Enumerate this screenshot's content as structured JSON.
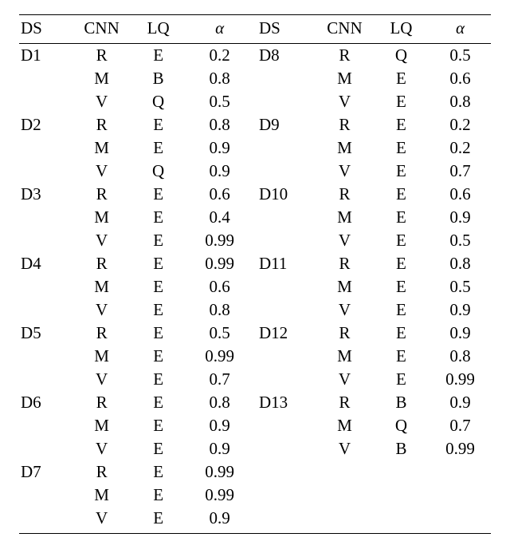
{
  "chart_data": {
    "type": "table",
    "title": "",
    "columns": [
      "DS",
      "CNN",
      "LQ",
      "alpha",
      "DS",
      "CNN",
      "LQ",
      "alpha"
    ],
    "rows": [
      [
        "D1",
        "R",
        "E",
        "0.2",
        "D8",
        "R",
        "Q",
        "0.5"
      ],
      [
        "",
        "M",
        "B",
        "0.8",
        "",
        "M",
        "E",
        "0.6"
      ],
      [
        "",
        "V",
        "Q",
        "0.5",
        "",
        "V",
        "E",
        "0.8"
      ],
      [
        "D2",
        "R",
        "E",
        "0.8",
        "D9",
        "R",
        "E",
        "0.2"
      ],
      [
        "",
        "M",
        "E",
        "0.9",
        "",
        "M",
        "E",
        "0.2"
      ],
      [
        "",
        "V",
        "Q",
        "0.9",
        "",
        "V",
        "E",
        "0.7"
      ],
      [
        "D3",
        "R",
        "E",
        "0.6",
        "D10",
        "R",
        "E",
        "0.6"
      ],
      [
        "",
        "M",
        "E",
        "0.4",
        "",
        "M",
        "E",
        "0.9"
      ],
      [
        "",
        "V",
        "E",
        "0.99",
        "",
        "V",
        "E",
        "0.5"
      ],
      [
        "D4",
        "R",
        "E",
        "0.99",
        "D11",
        "R",
        "E",
        "0.8"
      ],
      [
        "",
        "M",
        "E",
        "0.6",
        "",
        "M",
        "E",
        "0.5"
      ],
      [
        "",
        "V",
        "E",
        "0.8",
        "",
        "V",
        "E",
        "0.9"
      ],
      [
        "D5",
        "R",
        "E",
        "0.5",
        "D12",
        "R",
        "E",
        "0.9"
      ],
      [
        "",
        "M",
        "E",
        "0.99",
        "",
        "M",
        "E",
        "0.8"
      ],
      [
        "",
        "V",
        "E",
        "0.7",
        "",
        "V",
        "E",
        "0.99"
      ],
      [
        "D6",
        "R",
        "E",
        "0.8",
        "D13",
        "R",
        "B",
        "0.9"
      ],
      [
        "",
        "M",
        "E",
        "0.9",
        "",
        "M",
        "Q",
        "0.7"
      ],
      [
        "",
        "V",
        "E",
        "0.9",
        "",
        "V",
        "B",
        "0.99"
      ],
      [
        "D7",
        "R",
        "E",
        "0.99",
        "",
        "",
        "",
        ""
      ],
      [
        "",
        "M",
        "E",
        "0.99",
        "",
        "",
        "",
        ""
      ],
      [
        "",
        "V",
        "E",
        "0.9",
        "",
        "",
        "",
        ""
      ]
    ]
  },
  "headers": {
    "left": {
      "ds": "DS",
      "cnn": "CNN",
      "lq": "LQ",
      "alpha": "α"
    },
    "right": {
      "ds": "DS",
      "cnn": "CNN",
      "lq": "LQ",
      "alpha": "α"
    }
  }
}
